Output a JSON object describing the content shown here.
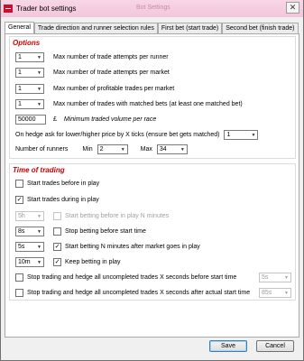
{
  "window": {
    "title": "Trader bot settings",
    "ghost_title": "Bot Settings",
    "close_glyph": "✕"
  },
  "tabs": [
    {
      "label": "General"
    },
    {
      "label": "Trade direction and runner selection rules"
    },
    {
      "label": "First bet (start trade)"
    },
    {
      "label": "Second bet (finish trade)"
    }
  ],
  "options": {
    "title": "Options",
    "max_trade_attempts_runner": {
      "value": "1",
      "label": "Max number of trade attempts per runner"
    },
    "max_trade_attempts_market": {
      "value": "1",
      "label": "Max number of trade attempts per market"
    },
    "max_profitable_trades_market": {
      "value": "1",
      "label": "Max number of profitable trades per market"
    },
    "max_matched_trades": {
      "value": "1",
      "label": "Max number of trades with matched bets (at least one matched bet)"
    },
    "min_volume": {
      "value": "50000",
      "currency": "£",
      "label": "Minimum traded volume per race"
    },
    "hedge_ticks": {
      "label": "On hedge ask for lower/higher price by X ticks (ensure bet gets matched)",
      "value": "1"
    },
    "runners": {
      "label": "Number of runners",
      "min_label": "Min",
      "min_value": "2",
      "max_label": "Max",
      "max_value": "34"
    }
  },
  "time_of_trading": {
    "title": "Time of trading",
    "start_before_play": {
      "label": "Start trades before in play",
      "checked": false
    },
    "start_during_play": {
      "label": "Start trades during in play",
      "checked": true
    },
    "before_play_n": {
      "value": "5h",
      "label": "Start betting before in play N minutes",
      "checked": false
    },
    "stop_before_start": {
      "value": "8s",
      "label": "Stop betting before start time",
      "checked": false
    },
    "start_after_market": {
      "value": "5s",
      "label": "Start betting N minutes after market goes in play",
      "checked": true
    },
    "keep_betting": {
      "value": "10m",
      "label": "Keep betting in play",
      "checked": true
    },
    "hedge_before_start": {
      "label": "Stop trading and hedge all uncompleted trades X seconds before start time",
      "value": "5s",
      "checked": false
    },
    "hedge_after_start": {
      "label": "Stop trading and hedge all uncompleted trades X seconds after actual start time",
      "value": "85s",
      "checked": false
    }
  },
  "buttons": {
    "save": "Save",
    "cancel": "Cancel"
  },
  "glyphs": {
    "check": "✓",
    "caret": "▼"
  }
}
